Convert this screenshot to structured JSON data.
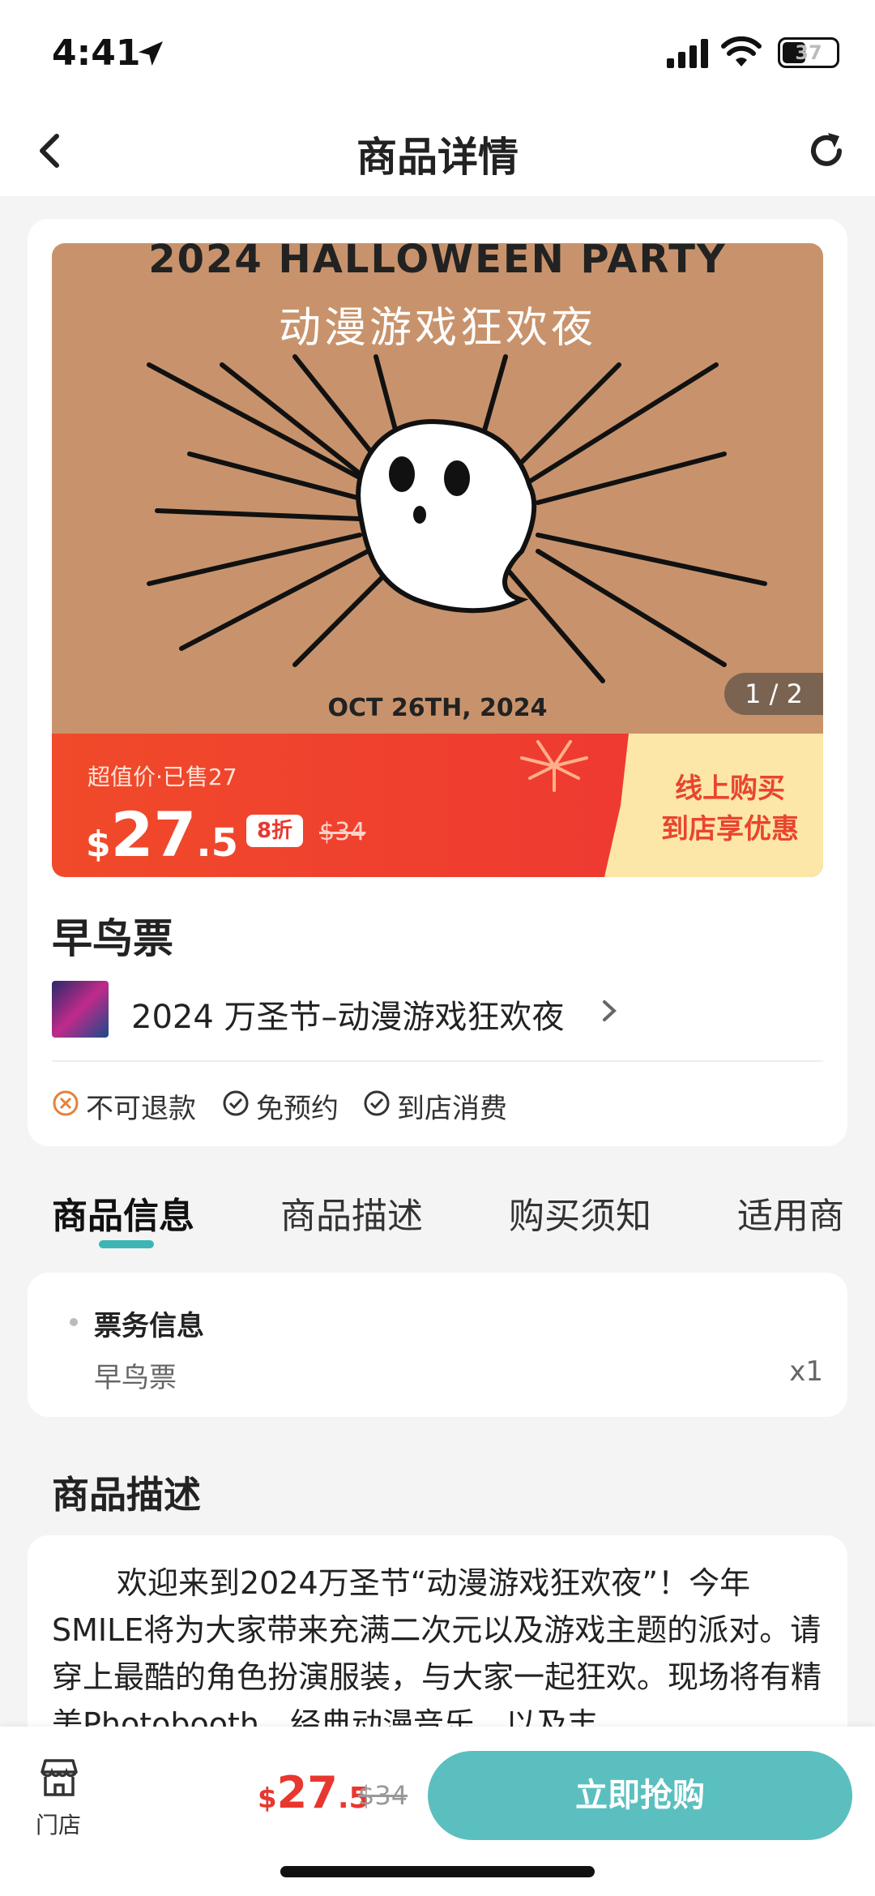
{
  "status_bar": {
    "time": "4:41",
    "battery": "37"
  },
  "nav": {
    "title": "商品详情",
    "back_icon": "chevron-left-icon",
    "refresh_icon": "refresh-icon"
  },
  "poster": {
    "title": "2024 HALLOWEEN PARTY",
    "subtitle": "动漫游戏狂欢夜",
    "date": "OCT 26TH, 2024",
    "counter": "1 / 2",
    "bg_color": "#c8936c"
  },
  "price_bar": {
    "label": "超值价·已售27",
    "currency": "$",
    "price_int": "27",
    "price_dec": ".5",
    "discount": "8折",
    "original": "$34",
    "promo_line1": "线上购买",
    "promo_line2": "到店享优惠"
  },
  "product": {
    "name": "早鸟票",
    "venue": "2024 万圣节–动漫游戏狂欢夜"
  },
  "tags": [
    {
      "label": "不可退款",
      "icon": "x-circle-icon",
      "color": "#e8803a"
    },
    {
      "label": "免预约",
      "icon": "check-circle-icon",
      "color": "#333333"
    },
    {
      "label": "到店消费",
      "icon": "check-circle-icon",
      "color": "#333333"
    }
  ],
  "tabs": [
    {
      "label": "商品信息",
      "active": true
    },
    {
      "label": "商品描述",
      "active": false
    },
    {
      "label": "购买须知",
      "active": false
    },
    {
      "label": "适用商",
      "active": false
    }
  ],
  "ticket_info": {
    "heading": "票务信息",
    "item_name": "早鸟票",
    "quantity": "x1"
  },
  "description": {
    "title": "商品描述",
    "text": "欢迎来到2024万圣节“动漫游戏狂欢夜”！今年SMILE将为大家带来充满二次元以及游戏主题的派对。请穿上最酷的角色扮演服装，与大家一起狂欢。现场将有精美Photobooth、经典动漫音乐，以及丰"
  },
  "bottom_bar": {
    "store_label": "门店",
    "currency": "$",
    "price_int": "27",
    "price_dec": ".5",
    "original": "$34",
    "buy_label": "立即抢购",
    "accent": "#5bbfbf"
  }
}
